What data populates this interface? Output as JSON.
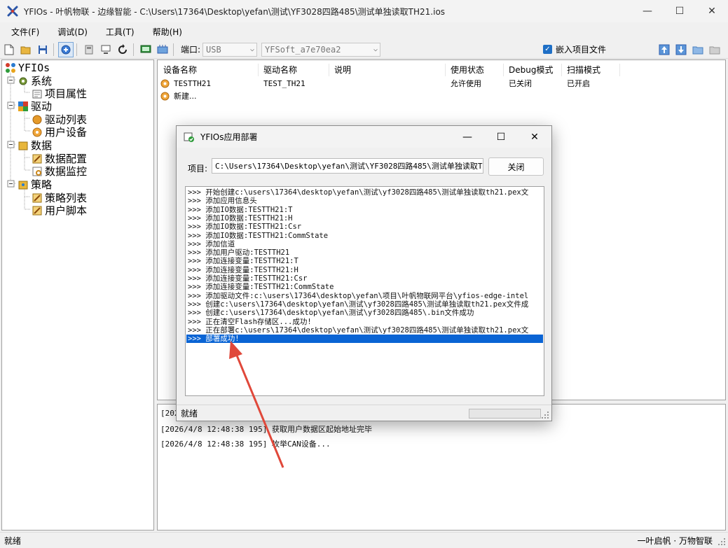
{
  "window": {
    "title": "YFIOs - 叶帆物联 - 边缘智能 - C:\\Users\\17364\\Desktop\\yefan\\测试\\YF3028四路485\\测试单独读取TH21.ios",
    "minimize": "—",
    "maximize": "☐",
    "close": "✕"
  },
  "menu": [
    {
      "label": "文件(F)"
    },
    {
      "label": "调试(D)"
    },
    {
      "label": "工具(T)"
    },
    {
      "label": "帮助(H)"
    }
  ],
  "toolbar": {
    "port_label": "端口:",
    "port_value": "USB",
    "device_value": "YFSoft_a7e70ea2",
    "embed_checkbox_label": "嵌入项目文件",
    "embed_checked": true
  },
  "tree": {
    "root": "YFIOs",
    "nodes": [
      {
        "label": "系统"
      },
      {
        "label": "项目属性"
      },
      {
        "label": "驱动"
      },
      {
        "label": "驱动列表"
      },
      {
        "label": "用户设备"
      },
      {
        "label": "数据"
      },
      {
        "label": "数据配置"
      },
      {
        "label": "数据监控"
      },
      {
        "label": "策略"
      },
      {
        "label": "策略列表"
      },
      {
        "label": "用户脚本"
      }
    ]
  },
  "device_table": {
    "columns": [
      "设备名称",
      "驱动名称",
      "说明",
      "使用状态",
      "Debug模式",
      "扫描模式"
    ],
    "rows": [
      {
        "name": "TESTTH21",
        "driver": "TEST_TH21",
        "desc": "",
        "status": "允许使用",
        "debug": "已关闭",
        "scan": "已开启"
      },
      {
        "name": "新建...",
        "driver": "",
        "desc": "",
        "status": "",
        "debug": "",
        "scan": ""
      }
    ]
  },
  "log": [
    "[202",
    "[2026/4/8 12:48:38 195] 获取用户数据区起始地址完毕",
    "[2026/4/8 12:48:38 195] 枚举CAN设备..."
  ],
  "status": {
    "left": "就绪",
    "right": "一叶启帆 · 万物智联"
  },
  "dialog": {
    "title": "YFIOs应用部署",
    "project_label": "项目:",
    "project_path": "C:\\Users\\17364\\Desktop\\yefan\\测试\\YF3028四路485\\测试单独读取TH",
    "close_button": "关闭",
    "output": [
      ">>> 开始创建c:\\users\\17364\\desktop\\yefan\\测试\\yf3028四路485\\测试单独读取th21.pex文",
      ">>> 添加应用信息头",
      ">>> 添加IO数据:TESTTH21:T",
      ">>> 添加IO数据:TESTTH21:H",
      ">>> 添加IO数据:TESTTH21:Csr",
      ">>> 添加IO数据:TESTTH21:CommState",
      ">>> 添加信道",
      ">>> 添加用户驱动:TESTTH21",
      ">>> 添加连接变量:TESTTH21:T",
      ">>> 添加连接变量:TESTTH21:H",
      ">>> 添加连接变量:TESTTH21:Csr",
      ">>> 添加连接变量:TESTTH21:CommState",
      ">>> 添加驱动文件:c:\\users\\17364\\desktop\\yefan\\项目\\叶帆物联网平台\\yfios-edge-intel",
      ">>> 创建c:\\users\\17364\\desktop\\yefan\\测试\\yf3028四路485\\测试单独读取th21.pex文件成",
      ">>> 创建c:\\users\\17364\\desktop\\yefan\\测试\\yf3028四路485\\.bin文件成功",
      ">>> 正在清空Flash存储区...成功!",
      ">>> 正在部署c:\\users\\17364\\desktop\\yefan\\测试\\yf3028四路485\\测试单独读取th21.pex文",
      ">>> 部署成功!"
    ],
    "selected_index": 17,
    "status": "就绪"
  },
  "colors": {
    "selection": "#0a64d4",
    "annotation_arrow": "#e0483a",
    "checkbox": "#1f6fc6"
  }
}
